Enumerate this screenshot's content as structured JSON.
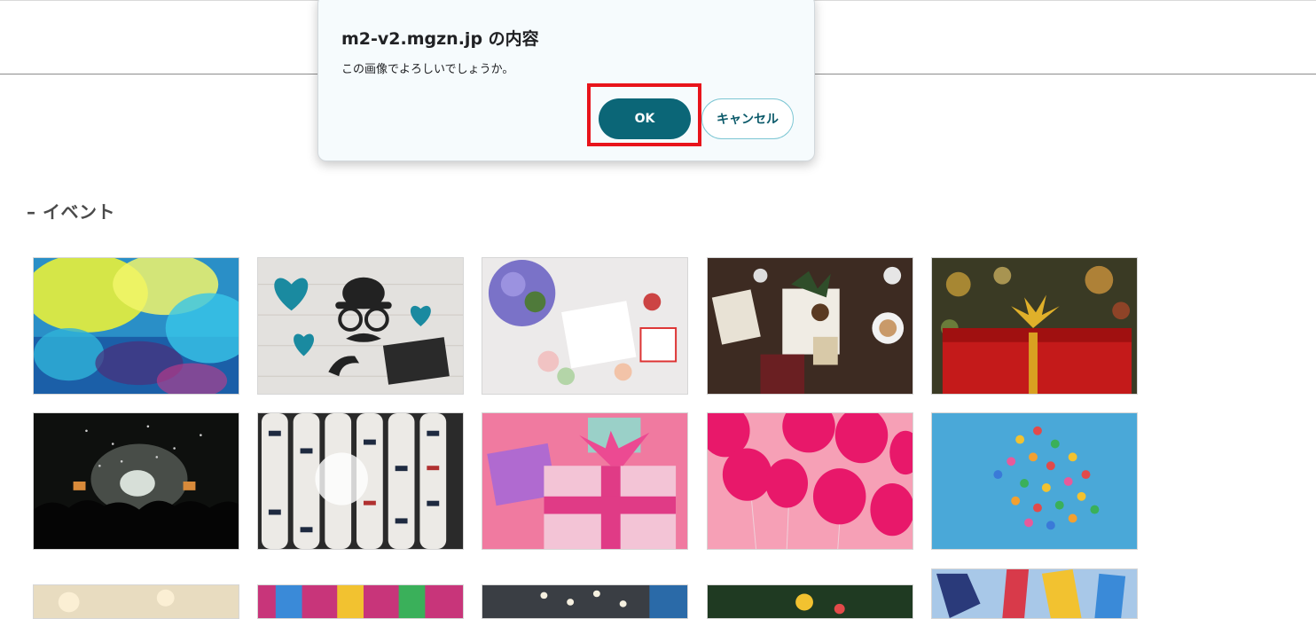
{
  "dialog": {
    "title": "m2-v2.mgzn.jp の内容",
    "message": "この画像でよろしいでしょうか。",
    "ok_label": "OK",
    "cancel_label": "キャンセル"
  },
  "section": {
    "title": "– イベント"
  },
  "gallery": {
    "images": [
      {
        "subject": "holi-color-festival"
      },
      {
        "subject": "fathers-day-mustache-hat"
      },
      {
        "subject": "mothers-day-card-flowers"
      },
      {
        "subject": "christmas-gift-pinecones"
      },
      {
        "subject": "red-gift-gold-ribbon-bokeh"
      },
      {
        "subject": "concert-confetti-crowd"
      },
      {
        "subject": "japanese-paper-lanterns"
      },
      {
        "subject": "pink-gift-boxes-ribbon"
      },
      {
        "subject": "pink-balloons"
      },
      {
        "subject": "colorful-balloons-sky"
      },
      {
        "subject": "bokeh-lights"
      },
      {
        "subject": "tanabata-decorations"
      },
      {
        "subject": "festival-lanterns-street"
      },
      {
        "subject": "christmas-tree-ornaments"
      },
      {
        "subject": "koinobori-carp-streamers"
      }
    ]
  },
  "colors": {
    "primary": "#0b6677",
    "highlight": "#e8141b"
  }
}
